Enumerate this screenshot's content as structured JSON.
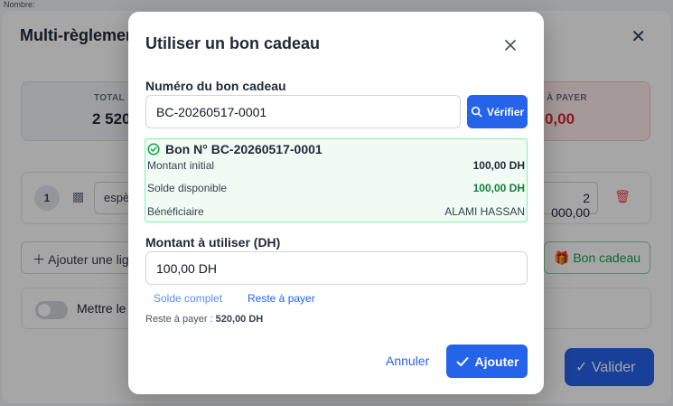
{
  "background": {
    "top_text": "Nombre:",
    "title": "Multi-règlement",
    "total_label": "TOTAL",
    "total_value": "2 520",
    "remaining_label": "À PAYER",
    "remaining_value": "0,00",
    "payment_row": {
      "index": "1",
      "method": "espè",
      "amount": "2 000,00"
    },
    "add_line_label": "Ajouter une ligne",
    "gift_button_label": "Bon cadeau",
    "toggle_label": "Mettre le",
    "validate_label": "Valider"
  },
  "modal": {
    "title": "Utiliser un bon cadeau",
    "voucher_number_label": "Numéro du bon cadeau",
    "voucher_number_value": "BC-20260517-0001",
    "verify_label": "Vérifier",
    "voucher": {
      "header": "Bon N° BC-20260517-0001",
      "initial_label": "Montant initial",
      "initial_value": "100,00 DH",
      "balance_label": "Solde disponible",
      "balance_value": "100,00 DH",
      "beneficiary_label": "Bénéficiaire",
      "beneficiary_value": "ALAMI HASSAN"
    },
    "amount_label": "Montant à utiliser (DH)",
    "amount_value": "100,00 DH",
    "quick_full_balance": "Solde complet",
    "quick_remaining": "Reste à payer",
    "remaining_prefix": "Reste à payer :",
    "remaining_value": "520,00 DH",
    "cancel_label": "Annuler",
    "add_label": "Ajouter"
  },
  "colors": {
    "primary": "#2563eb",
    "success": "#15803d",
    "success_border": "#86efac",
    "danger": "#ef4444"
  }
}
